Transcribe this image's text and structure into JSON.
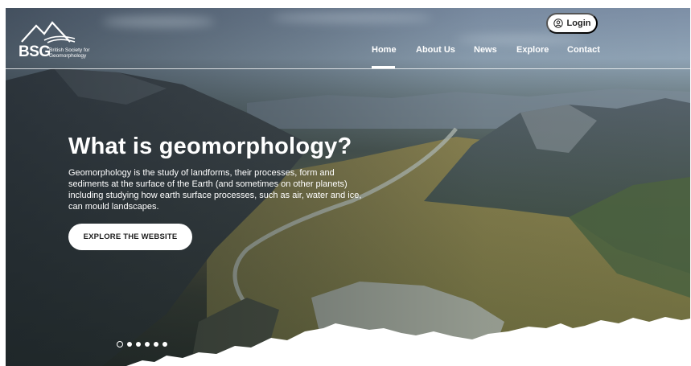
{
  "brand": {
    "short": "BSG",
    "full": "British Society for Geomorphology"
  },
  "header": {
    "login_label": "Login",
    "nav": [
      {
        "label": "Home",
        "active": true
      },
      {
        "label": "About Us",
        "active": false
      },
      {
        "label": "News",
        "active": false
      },
      {
        "label": "Explore",
        "active": false
      },
      {
        "label": "Contact",
        "active": false
      }
    ]
  },
  "hero": {
    "title": "What is geomorphology?",
    "description": "Geomorphology is the study of landforms, their processes, form and sediments at the surface of the Earth (and sometimes on other planets) including studying how earth surface processes, such as air, water and ice, can mould landscapes.",
    "cta_label": "EXPLORE THE WEBSITE"
  },
  "carousel": {
    "slide_count": 6,
    "active_index": 0
  },
  "colors": {
    "text_on_image": "#ffffff",
    "button_bg": "#ffffff",
    "button_text": "#1d1d1d"
  },
  "icons": {
    "login": "user-circle-icon",
    "logo": "mountain-logo-icon"
  }
}
